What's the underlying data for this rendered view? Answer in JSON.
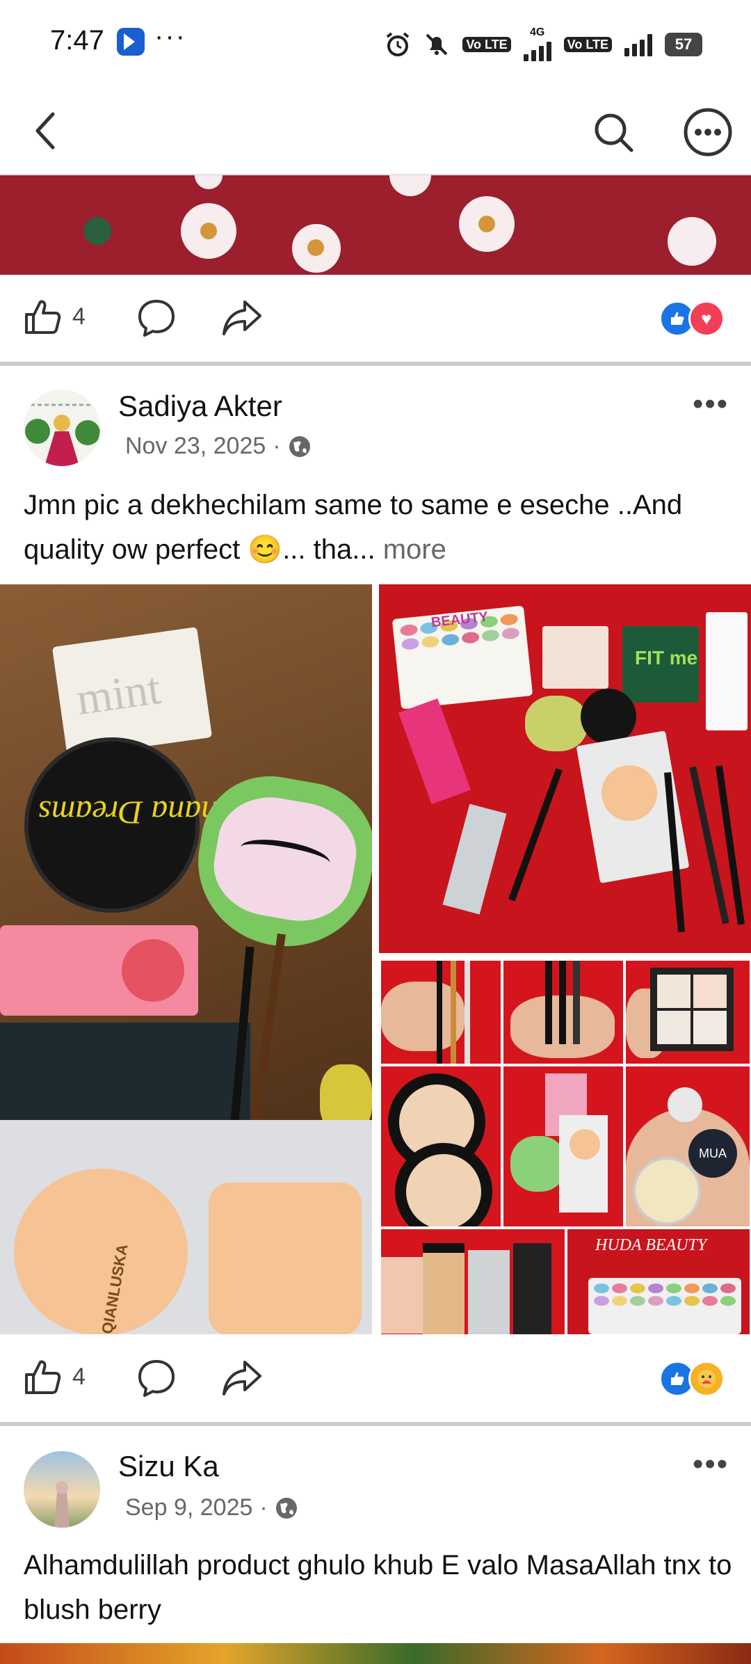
{
  "status_bar": {
    "time": "7:47",
    "dots": "···",
    "lte1": "Vo LTE",
    "net": "4G",
    "lte2": "Vo LTE",
    "battery": "57"
  },
  "nav": {
    "back_icon": "chevron-left-icon",
    "search_icon": "search-icon",
    "more_icon": "more-circle-icon"
  },
  "posts": [
    {
      "likes": "4",
      "reactions": [
        "like",
        "love"
      ]
    },
    {
      "author": "Sadiya Akter",
      "date": "Nov 23, 2025",
      "dot": "·",
      "text": "Jmn pic a dekhechilam same to same e eseche ..And quality ow perfect 😊... tha...",
      "more": "more",
      "likes": "4",
      "reactions": [
        "like",
        "care"
      ],
      "photo_labels": {
        "powder": "Banana Dreams",
        "mint": "mint",
        "sponge": "QIANLUSKA",
        "palette": "BEAUTY",
        "fit": "FIT me",
        "mua": "MUA",
        "huda": "HUDA BEAUTY"
      }
    },
    {
      "author": "Sizu Ka",
      "date": "Sep 9, 2025",
      "dot": "·",
      "text": "Alhamdulillah product ghulo khub E valo MasaAllah tnx to blush berry"
    }
  ],
  "colors": {
    "facebook_blue": "#1b74e4",
    "love_red": "#f33e58",
    "meta_gray": "#65676b"
  }
}
